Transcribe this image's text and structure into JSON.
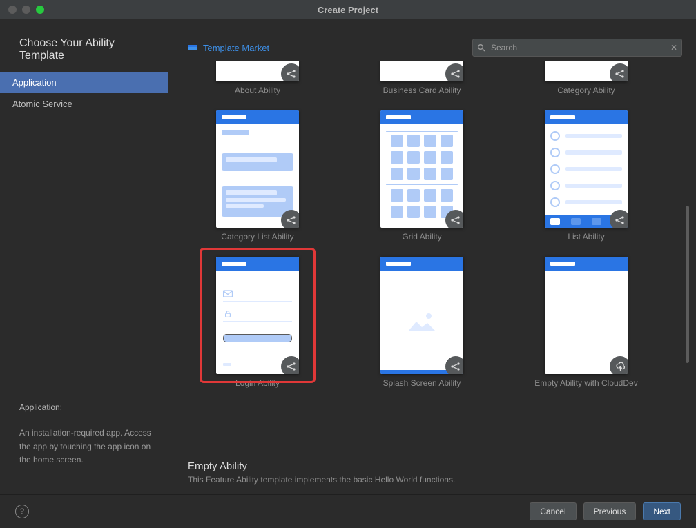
{
  "window": {
    "title": "Create Project"
  },
  "sidebar": {
    "heading": "Choose Your Ability Template",
    "items": [
      {
        "label": "Application",
        "selected": true
      },
      {
        "label": "Atomic Service",
        "selected": false
      }
    ],
    "desc_label": "Application:",
    "desc_text": "An installation-required app. Access the app by touching the app icon on the home screen."
  },
  "top": {
    "template_market": "Template Market",
    "search_placeholder": "Search"
  },
  "templates": {
    "row1": [
      "About Ability",
      "Business Card Ability",
      "Category Ability"
    ],
    "row2": [
      "Category List Ability",
      "Grid Ability",
      "List Ability"
    ],
    "row3": [
      "Login Ability",
      "Splash Screen Ability",
      "Empty Ability with CloudDev"
    ]
  },
  "section": {
    "title": "Empty Ability",
    "subtitle": "This Feature Ability template implements the basic Hello World functions."
  },
  "footer": {
    "cancel": "Cancel",
    "previous": "Previous",
    "next": "Next"
  }
}
